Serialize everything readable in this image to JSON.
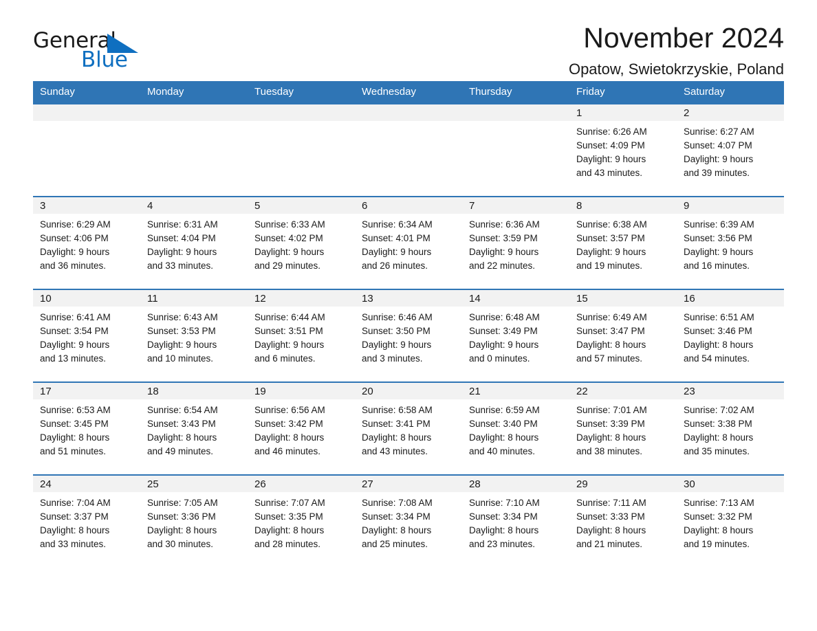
{
  "brand": {
    "name_part1": "General",
    "name_part2": "Blue",
    "mark": "triangle-logo"
  },
  "header": {
    "month_title": "November 2024",
    "location": "Opatow, Swietokrzyskie, Poland"
  },
  "theme": {
    "header_blue": "#2f75b5",
    "daynum_band": "#f2f2f2",
    "brand_blue": "#0f6fc0",
    "text": "#1a1a1a"
  },
  "weekday_headers": [
    "Sunday",
    "Monday",
    "Tuesday",
    "Wednesday",
    "Thursday",
    "Friday",
    "Saturday"
  ],
  "weeks": [
    [
      {
        "day": "",
        "sunrise": "",
        "sunset": "",
        "daylight_line1": "",
        "daylight_line2": ""
      },
      {
        "day": "",
        "sunrise": "",
        "sunset": "",
        "daylight_line1": "",
        "daylight_line2": ""
      },
      {
        "day": "",
        "sunrise": "",
        "sunset": "",
        "daylight_line1": "",
        "daylight_line2": ""
      },
      {
        "day": "",
        "sunrise": "",
        "sunset": "",
        "daylight_line1": "",
        "daylight_line2": ""
      },
      {
        "day": "",
        "sunrise": "",
        "sunset": "",
        "daylight_line1": "",
        "daylight_line2": ""
      },
      {
        "day": "1",
        "sunrise": "Sunrise: 6:26 AM",
        "sunset": "Sunset: 4:09 PM",
        "daylight_line1": "Daylight: 9 hours",
        "daylight_line2": "and 43 minutes."
      },
      {
        "day": "2",
        "sunrise": "Sunrise: 6:27 AM",
        "sunset": "Sunset: 4:07 PM",
        "daylight_line1": "Daylight: 9 hours",
        "daylight_line2": "and 39 minutes."
      }
    ],
    [
      {
        "day": "3",
        "sunrise": "Sunrise: 6:29 AM",
        "sunset": "Sunset: 4:06 PM",
        "daylight_line1": "Daylight: 9 hours",
        "daylight_line2": "and 36 minutes."
      },
      {
        "day": "4",
        "sunrise": "Sunrise: 6:31 AM",
        "sunset": "Sunset: 4:04 PM",
        "daylight_line1": "Daylight: 9 hours",
        "daylight_line2": "and 33 minutes."
      },
      {
        "day": "5",
        "sunrise": "Sunrise: 6:33 AM",
        "sunset": "Sunset: 4:02 PM",
        "daylight_line1": "Daylight: 9 hours",
        "daylight_line2": "and 29 minutes."
      },
      {
        "day": "6",
        "sunrise": "Sunrise: 6:34 AM",
        "sunset": "Sunset: 4:01 PM",
        "daylight_line1": "Daylight: 9 hours",
        "daylight_line2": "and 26 minutes."
      },
      {
        "day": "7",
        "sunrise": "Sunrise: 6:36 AM",
        "sunset": "Sunset: 3:59 PM",
        "daylight_line1": "Daylight: 9 hours",
        "daylight_line2": "and 22 minutes."
      },
      {
        "day": "8",
        "sunrise": "Sunrise: 6:38 AM",
        "sunset": "Sunset: 3:57 PM",
        "daylight_line1": "Daylight: 9 hours",
        "daylight_line2": "and 19 minutes."
      },
      {
        "day": "9",
        "sunrise": "Sunrise: 6:39 AM",
        "sunset": "Sunset: 3:56 PM",
        "daylight_line1": "Daylight: 9 hours",
        "daylight_line2": "and 16 minutes."
      }
    ],
    [
      {
        "day": "10",
        "sunrise": "Sunrise: 6:41 AM",
        "sunset": "Sunset: 3:54 PM",
        "daylight_line1": "Daylight: 9 hours",
        "daylight_line2": "and 13 minutes."
      },
      {
        "day": "11",
        "sunrise": "Sunrise: 6:43 AM",
        "sunset": "Sunset: 3:53 PM",
        "daylight_line1": "Daylight: 9 hours",
        "daylight_line2": "and 10 minutes."
      },
      {
        "day": "12",
        "sunrise": "Sunrise: 6:44 AM",
        "sunset": "Sunset: 3:51 PM",
        "daylight_line1": "Daylight: 9 hours",
        "daylight_line2": "and 6 minutes."
      },
      {
        "day": "13",
        "sunrise": "Sunrise: 6:46 AM",
        "sunset": "Sunset: 3:50 PM",
        "daylight_line1": "Daylight: 9 hours",
        "daylight_line2": "and 3 minutes."
      },
      {
        "day": "14",
        "sunrise": "Sunrise: 6:48 AM",
        "sunset": "Sunset: 3:49 PM",
        "daylight_line1": "Daylight: 9 hours",
        "daylight_line2": "and 0 minutes."
      },
      {
        "day": "15",
        "sunrise": "Sunrise: 6:49 AM",
        "sunset": "Sunset: 3:47 PM",
        "daylight_line1": "Daylight: 8 hours",
        "daylight_line2": "and 57 minutes."
      },
      {
        "day": "16",
        "sunrise": "Sunrise: 6:51 AM",
        "sunset": "Sunset: 3:46 PM",
        "daylight_line1": "Daylight: 8 hours",
        "daylight_line2": "and 54 minutes."
      }
    ],
    [
      {
        "day": "17",
        "sunrise": "Sunrise: 6:53 AM",
        "sunset": "Sunset: 3:45 PM",
        "daylight_line1": "Daylight: 8 hours",
        "daylight_line2": "and 51 minutes."
      },
      {
        "day": "18",
        "sunrise": "Sunrise: 6:54 AM",
        "sunset": "Sunset: 3:43 PM",
        "daylight_line1": "Daylight: 8 hours",
        "daylight_line2": "and 49 minutes."
      },
      {
        "day": "19",
        "sunrise": "Sunrise: 6:56 AM",
        "sunset": "Sunset: 3:42 PM",
        "daylight_line1": "Daylight: 8 hours",
        "daylight_line2": "and 46 minutes."
      },
      {
        "day": "20",
        "sunrise": "Sunrise: 6:58 AM",
        "sunset": "Sunset: 3:41 PM",
        "daylight_line1": "Daylight: 8 hours",
        "daylight_line2": "and 43 minutes."
      },
      {
        "day": "21",
        "sunrise": "Sunrise: 6:59 AM",
        "sunset": "Sunset: 3:40 PM",
        "daylight_line1": "Daylight: 8 hours",
        "daylight_line2": "and 40 minutes."
      },
      {
        "day": "22",
        "sunrise": "Sunrise: 7:01 AM",
        "sunset": "Sunset: 3:39 PM",
        "daylight_line1": "Daylight: 8 hours",
        "daylight_line2": "and 38 minutes."
      },
      {
        "day": "23",
        "sunrise": "Sunrise: 7:02 AM",
        "sunset": "Sunset: 3:38 PM",
        "daylight_line1": "Daylight: 8 hours",
        "daylight_line2": "and 35 minutes."
      }
    ],
    [
      {
        "day": "24",
        "sunrise": "Sunrise: 7:04 AM",
        "sunset": "Sunset: 3:37 PM",
        "daylight_line1": "Daylight: 8 hours",
        "daylight_line2": "and 33 minutes."
      },
      {
        "day": "25",
        "sunrise": "Sunrise: 7:05 AM",
        "sunset": "Sunset: 3:36 PM",
        "daylight_line1": "Daylight: 8 hours",
        "daylight_line2": "and 30 minutes."
      },
      {
        "day": "26",
        "sunrise": "Sunrise: 7:07 AM",
        "sunset": "Sunset: 3:35 PM",
        "daylight_line1": "Daylight: 8 hours",
        "daylight_line2": "and 28 minutes."
      },
      {
        "day": "27",
        "sunrise": "Sunrise: 7:08 AM",
        "sunset": "Sunset: 3:34 PM",
        "daylight_line1": "Daylight: 8 hours",
        "daylight_line2": "and 25 minutes."
      },
      {
        "day": "28",
        "sunrise": "Sunrise: 7:10 AM",
        "sunset": "Sunset: 3:34 PM",
        "daylight_line1": "Daylight: 8 hours",
        "daylight_line2": "and 23 minutes."
      },
      {
        "day": "29",
        "sunrise": "Sunrise: 7:11 AM",
        "sunset": "Sunset: 3:33 PM",
        "daylight_line1": "Daylight: 8 hours",
        "daylight_line2": "and 21 minutes."
      },
      {
        "day": "30",
        "sunrise": "Sunrise: 7:13 AM",
        "sunset": "Sunset: 3:32 PM",
        "daylight_line1": "Daylight: 8 hours",
        "daylight_line2": "and 19 minutes."
      }
    ]
  ]
}
